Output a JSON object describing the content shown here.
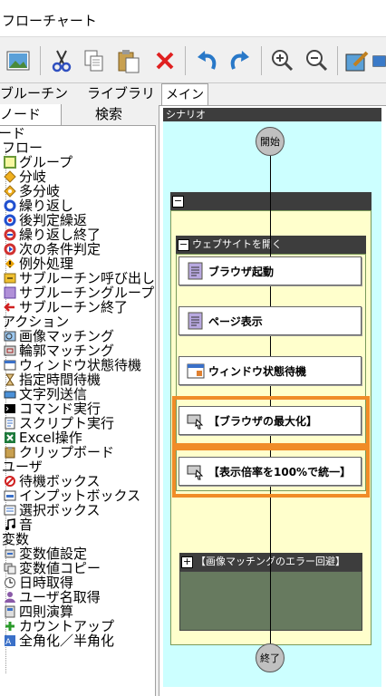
{
  "window": {
    "title": "フローチャート"
  },
  "toolbar": {
    "buttons": [
      {
        "icon": "image-icon"
      },
      {
        "icon": "cut-icon"
      },
      {
        "icon": "copy-icon"
      },
      {
        "icon": "paste-icon"
      },
      {
        "icon": "delete-icon"
      },
      {
        "icon": "undo-icon"
      },
      {
        "icon": "redo-icon"
      },
      {
        "icon": "zoom-in-icon"
      },
      {
        "icon": "zoom-out-icon"
      },
      {
        "icon": "edit-icon"
      },
      {
        "icon": "extra-icon"
      }
    ]
  },
  "left_tabs": {
    "row1": [
      "ブルーチン",
      "ライブラリ"
    ],
    "row2": [
      "ノード",
      "検索"
    ]
  },
  "tree": {
    "root": "ード",
    "flow_group": "フロー",
    "flow_items": [
      "グループ",
      "分岐",
      "多分岐",
      "繰り返し",
      "後判定繰返",
      "繰り返し終了",
      "次の条件判定",
      "例外処理",
      "サブルーチン呼び出し",
      "サブルーチングループ",
      "サブルーチン終了"
    ],
    "action_group": "アクション",
    "action_items": [
      "画像マッチング",
      "輪郭マッチング",
      "ウィンドウ状態待機",
      "指定時間待機",
      "文字列送信",
      "コマンド実行",
      "スクリプト実行",
      "Excel操作",
      "クリップボード"
    ],
    "user_group": "ユーザ",
    "user_items": [
      "待機ボックス",
      "インプットボックス",
      "選択ボックス"
    ],
    "sound_item": "音",
    "var_group": "変数",
    "var_items": [
      "変数値設定",
      "変数値コピー",
      "日時取得",
      "ユーザ名取得",
      "四則演算",
      "カウントアップ",
      "全角化／半角化"
    ]
  },
  "main": {
    "tab": "メイン",
    "scenario_label": "シナリオ",
    "start": "開始",
    "end": "終了",
    "group_label": "",
    "website_group": "ウェブサイトを開く",
    "actions": [
      "ブラウザ起動",
      "ページ表示",
      "ウィンドウ状態待機"
    ],
    "highlighted_actions": [
      "【ブラウザの最大化】",
      "【表示倍率を100%で統一】"
    ],
    "error_group": "【画像マッチングのエラー回避】"
  },
  "colors": {
    "highlight": "#f08c28",
    "scenario_bg": "#ccffff",
    "group_bg": "#ffffcc",
    "error_bg": "#677a5f"
  }
}
